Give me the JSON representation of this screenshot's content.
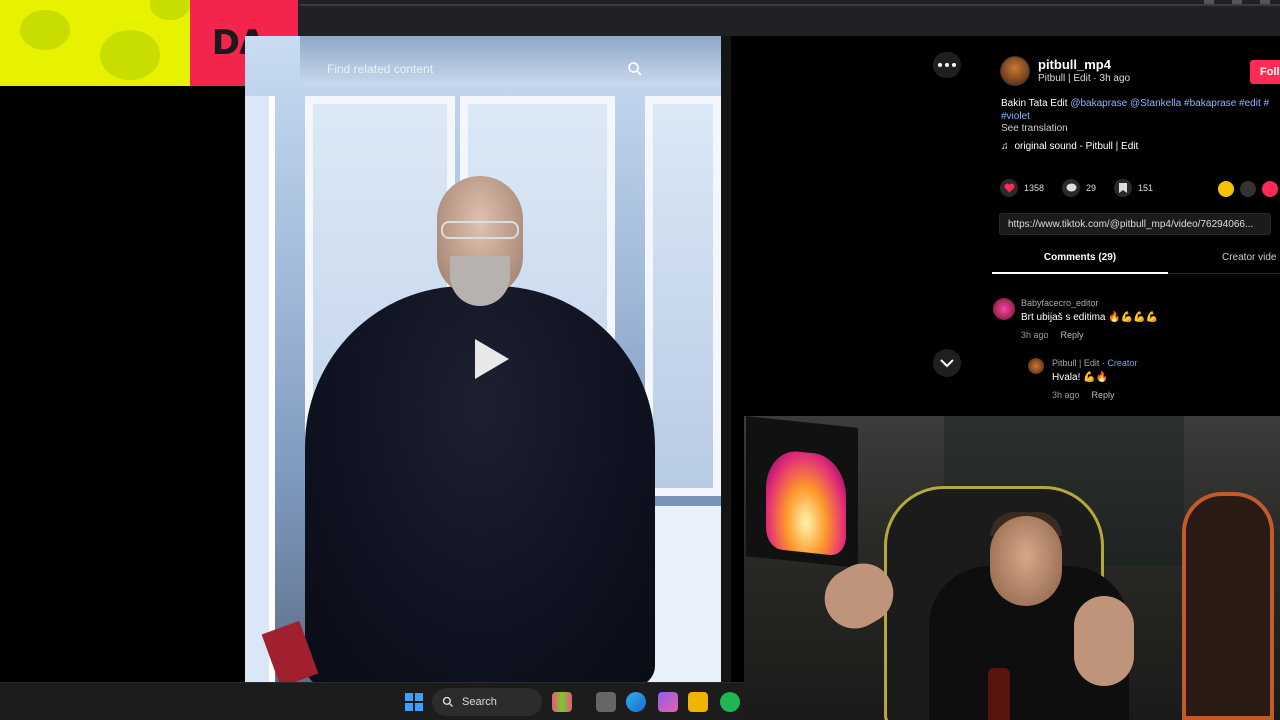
{
  "overlay": {
    "brand_text": "DA"
  },
  "video": {
    "search_placeholder": "Find related content"
  },
  "post": {
    "username": "pitbull_mp4",
    "subtitle": "Pitbull | Edit · 3h ago",
    "follow_label": "Foll",
    "description_plain": "Bakin Tata Edit ",
    "description_tags": "@bakaprase @Stankella #bakaprase #edit #",
    "description_tag2": "#violet",
    "see_translation": "See translation",
    "sound": "original sound - Pitbull | Edit",
    "likes": "1358",
    "comments_count": "29",
    "saves": "151",
    "url": "https://www.tiktok.com/@pitbull_mp4/video/76294066..."
  },
  "tabs": {
    "comments": "Comments (29)",
    "creator": "Creator vide"
  },
  "comment": {
    "user": "Babyfacecro_editor",
    "text": "Brt ubijaš s editima 🔥💪💪💪",
    "time": "3h ago",
    "reply_label": "Reply"
  },
  "reply": {
    "user": "Pitbull | Edit · ",
    "creator_label": "Creator",
    "text": "Hvala! 💪🔥",
    "time": "3h ago",
    "reply_label": "Reply"
  },
  "taskbar": {
    "search_label": "Search"
  },
  "colors": {
    "follow": "#fe2c55",
    "tag": "#8fb8ff",
    "creator": "#5fa8ff",
    "brand_yellow": "#e6f200",
    "brand_red": "#f4254d"
  },
  "icons": [
    "search-icon",
    "play-icon",
    "more-icon",
    "chevron-down-icon",
    "music-note-icon",
    "heart-icon",
    "comment-icon",
    "bookmark-icon",
    "windows-icon"
  ]
}
